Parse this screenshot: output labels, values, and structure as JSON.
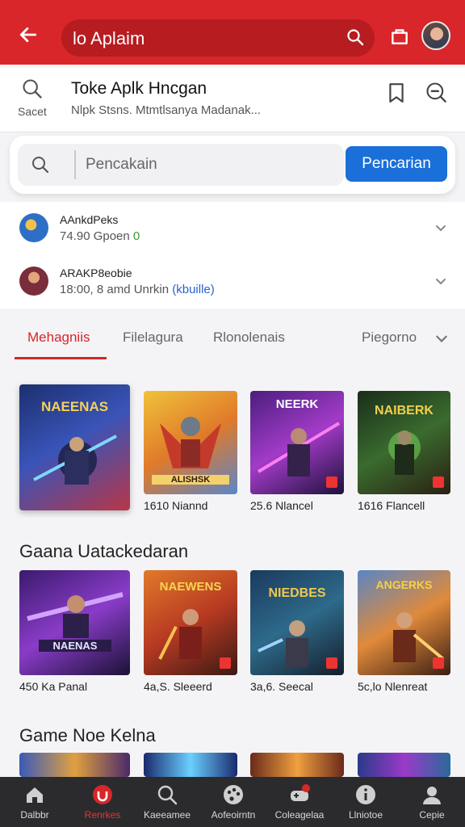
{
  "topbar": {
    "search_text": "lo Aplaim",
    "back_icon": "back-arrow-icon",
    "bag_icon": "bag-icon"
  },
  "header": {
    "search_label": "Sacet",
    "title": "Toke Aplk Hncgan",
    "subtitle": "Nlpk Stsns. Mtmtlsanya Madanak..."
  },
  "search": {
    "placeholder": "Pencakain",
    "button_label": "Pencarian"
  },
  "suggestions": [
    {
      "name": "AAnkdPeks",
      "meta_main": "74.90 Gpoen",
      "meta_extra": "0"
    },
    {
      "name": "ARAKP8eobie",
      "meta_main": "18:00, 8 amd Unrkin",
      "meta_extra": "(kbuille)"
    }
  ],
  "tabs": [
    {
      "label": "Mehagniis"
    },
    {
      "label": "Filelagura"
    },
    {
      "label": "Rlonolenais"
    },
    {
      "label": "Piegorno"
    }
  ],
  "sections": [
    {
      "title": "",
      "games": [
        {
          "art": "NAEENAS",
          "label": ""
        },
        {
          "art": "ALISHSK",
          "label": "1610 Niannd"
        },
        {
          "art": "NEERK",
          "label": "25.6 Nlancel"
        },
        {
          "art": "NAIBERK",
          "label": "1616 Flancell"
        }
      ]
    },
    {
      "title": "Gaana Uatackedaran",
      "games": [
        {
          "art": "NAENAS",
          "label": "450 Ka Panal"
        },
        {
          "art": "NAEWENS",
          "label": "4a,S. Sleeerd"
        },
        {
          "art": "NIEDBES",
          "label": "3a,6. Seecal"
        },
        {
          "art": "ANGERKS",
          "label": "5c,lo Nlenreat"
        }
      ]
    },
    {
      "title": "Game Noe Kelna",
      "games": [
        {
          "art": "",
          "label": ""
        },
        {
          "art": "",
          "label": ""
        },
        {
          "art": "",
          "label": ""
        },
        {
          "art": "",
          "label": ""
        }
      ]
    }
  ],
  "bottom_nav": [
    {
      "label": "Dalbbr",
      "icon": "home-icon"
    },
    {
      "label": "Renrkes",
      "icon": "brand-icon"
    },
    {
      "label": "Kaeeamee",
      "icon": "search-icon"
    },
    {
      "label": "Aofeoirntn",
      "icon": "palette-icon"
    },
    {
      "label": "Coleagelaa",
      "icon": "gamepad-icon"
    },
    {
      "label": "Llniotoe",
      "icon": "info-icon"
    },
    {
      "label": "Cepie",
      "icon": "profile-icon"
    }
  ],
  "colors": {
    "accent": "#d8262a",
    "button": "#1a6fd9",
    "nav_bg": "#2b2b2d"
  }
}
